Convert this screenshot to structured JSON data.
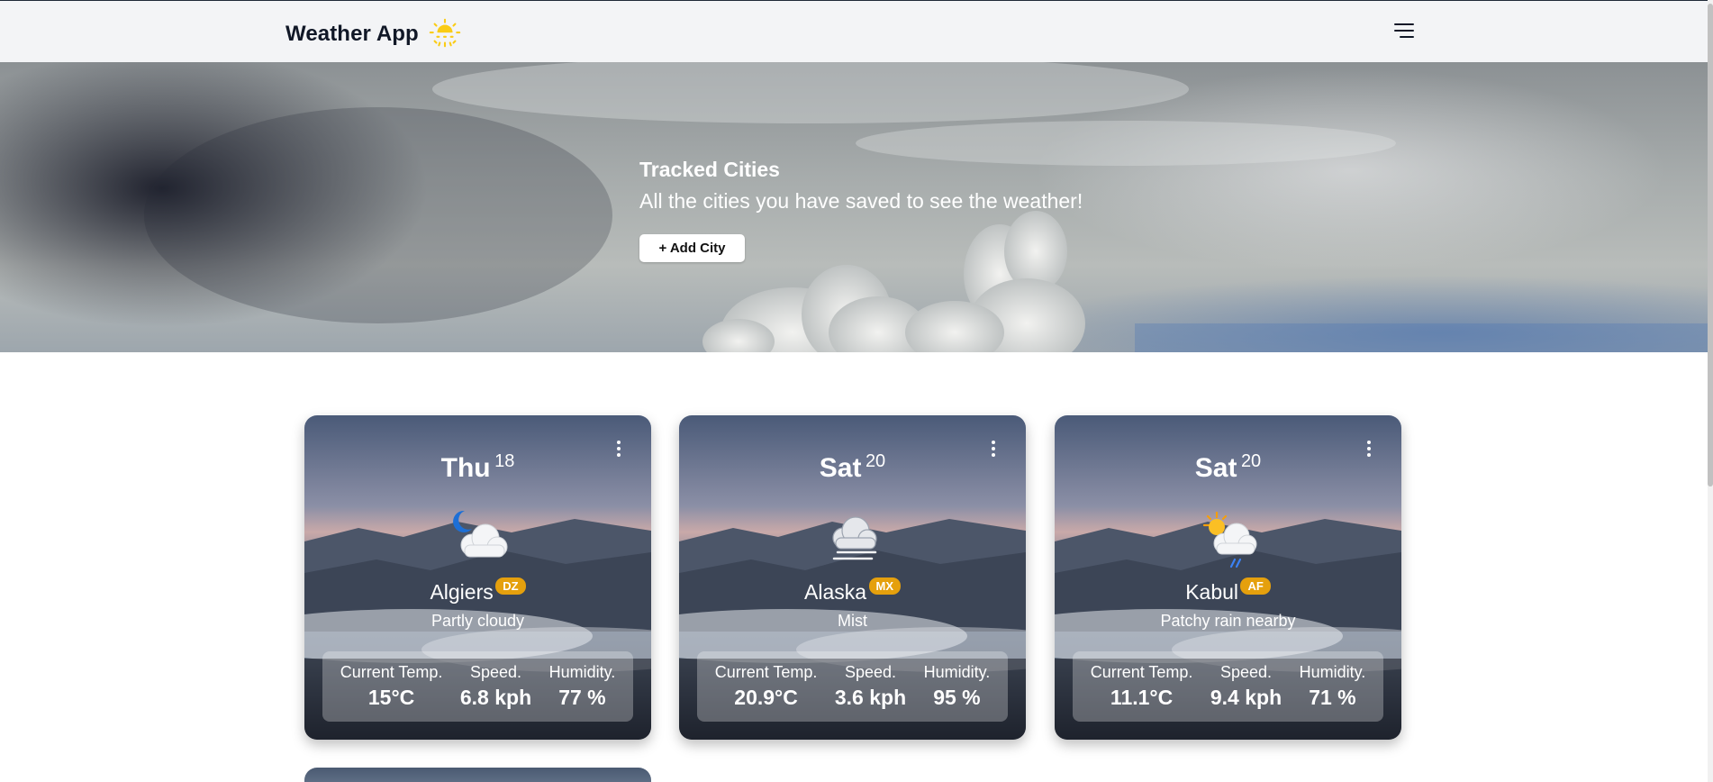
{
  "header": {
    "title": "Weather App",
    "logo_icon": "sun-icon",
    "menu_icon": "hamburger-menu-icon"
  },
  "hero": {
    "title": "Tracked Cities",
    "subtitle": "All the cities you have saved to see the weather!",
    "add_button_label": "+ Add City"
  },
  "cards": [
    {
      "day": "Thu",
      "date": "18",
      "icon": "partly-cloudy-night-icon",
      "city": "Algiers",
      "country": "DZ",
      "condition": "Partly cloudy",
      "temp_label": "Current Temp.",
      "temp": "15°C",
      "speed_label": "Speed.",
      "speed": "6.8 kph",
      "humidity_label": "Humidity.",
      "humidity": "77 %"
    },
    {
      "day": "Sat",
      "date": "20",
      "icon": "mist-icon",
      "city": "Alaska",
      "country": "MX",
      "condition": "Mist",
      "temp_label": "Current Temp.",
      "temp": "20.9°C",
      "speed_label": "Speed.",
      "speed": "3.6 kph",
      "humidity_label": "Humidity.",
      "humidity": "95 %"
    },
    {
      "day": "Sat",
      "date": "20",
      "icon": "patchy-rain-icon",
      "city": "Kabul",
      "country": "AF",
      "condition": "Patchy rain nearby",
      "temp_label": "Current Temp.",
      "temp": "11.1°C",
      "speed_label": "Speed.",
      "speed": "9.4 kph",
      "humidity_label": "Humidity.",
      "humidity": "71 %"
    }
  ],
  "colors": {
    "header_bg": "#f3f4f6",
    "badge": "#e5a00d",
    "accent_sun": "#facc15"
  }
}
